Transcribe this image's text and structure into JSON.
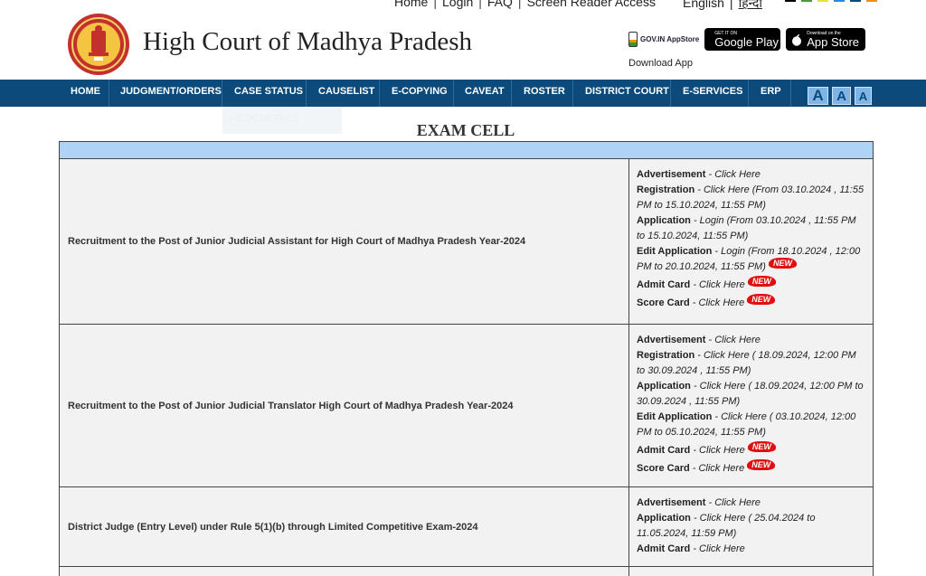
{
  "top_links": {
    "home": "Home",
    "login": "Login",
    "faq": "FAQ",
    "screen_reader": "Screen Reader Access",
    "english": "English",
    "hindi": "हिन्दी"
  },
  "theme_swatch_colors": [
    "#000000",
    "#4a9a3a",
    "#e5e23a",
    "#2a8ad8",
    "#0b4a7a",
    "#f28c1e"
  ],
  "header": {
    "title": "High Court of Madhya Pradesh",
    "gov_appstore": "GOV.IN AppStore",
    "google_play_small": "GET IT ON",
    "google_play": "Google Play",
    "app_store_small": "Download on the",
    "app_store": "App Store",
    "download_app": "Download App"
  },
  "nav": {
    "items": [
      "HOME",
      "JUDGMENT/ORDERS",
      "CASE STATUS",
      "CAUSELIST",
      "E-COPYING",
      "CAVEAT",
      "ROSTER",
      "DISTRICT COURT",
      "E-SERVICES",
      "ERP"
    ],
    "submenu_item": "HC DC DETAILS",
    "font_buttons": [
      "A",
      "A",
      "A"
    ]
  },
  "page_title": "EXAM CELL",
  "new_badge": "NEW",
  "rows": [
    {
      "name": "Recruitment to the Post of Junior Judicial Assistant for High Court of Madhya Pradesh Year-2024",
      "lines": [
        {
          "label": "Advertisement",
          "text": " - Click Here"
        },
        {
          "label": "Registration",
          "text": " - Click Here (From 03.10.2024 , 11:55 PM to 15.10.2024, 11:55 PM)"
        },
        {
          "label": "Application",
          "text": " - Login (From 03.10.2024 , 11:55 PM to 15.10.2024, 11:55 PM)"
        },
        {
          "label": "Edit Application",
          "text": " - Login (From 18.10.2024 , 12:00 PM to 20.10.2024, 11:55 PM)"
        },
        {
          "label": "Admit Card",
          "text": " - Click Here"
        },
        {
          "label": "Score Card",
          "text": " - Click Here"
        }
      ]
    },
    {
      "name": "Recruitment to the Post of Junior Judicial Translator High Court of Madhya Pradesh Year-2024",
      "lines": [
        {
          "label": "Advertisement",
          "text": " - Click Here"
        },
        {
          "label": "Registration",
          "text": " - Click Here ( 18.09.2024, 12:00 PM to 30.09.2024 , 11:55 PM)"
        },
        {
          "label": "Application",
          "text": " - Click Here ( 18.09.2024, 12:00 PM to 30.09.2024 , 11:55 PM)"
        },
        {
          "label": "Edit Application",
          "text": " - Click Here ( 03.10.2024, 12:00 PM to 05.10.2024, 11:55 PM)"
        },
        {
          "label": "Admit Card",
          "text": " - Click Here"
        },
        {
          "label": "Score Card",
          "text": " - Click Here"
        }
      ]
    },
    {
      "name": "District Judge (Entry Level) under Rule 5(1)(b) through Limited Competitive Exam-2024",
      "lines": [
        {
          "label": "Advertisement",
          "text": " - Click Here"
        },
        {
          "label": "Application",
          "text": " - Click Here ( 25.04.2024 to 11.05.2024, 11:59 PM)"
        },
        {
          "label": "Admit Card",
          "text": " - Click Here"
        }
      ]
    }
  ]
}
